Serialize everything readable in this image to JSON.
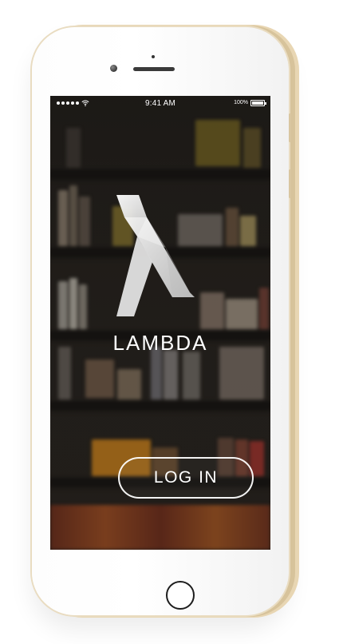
{
  "status_bar": {
    "time": "9:41 AM",
    "battery": "100%"
  },
  "app": {
    "name": "LAMBDA",
    "logo_icon": "lambda-logo-icon"
  },
  "actions": {
    "login_label": "LOG IN"
  },
  "colors": {
    "gold_frame": "#d9c6a0",
    "screen_dark": "#1a1612",
    "white": "#ffffff"
  }
}
